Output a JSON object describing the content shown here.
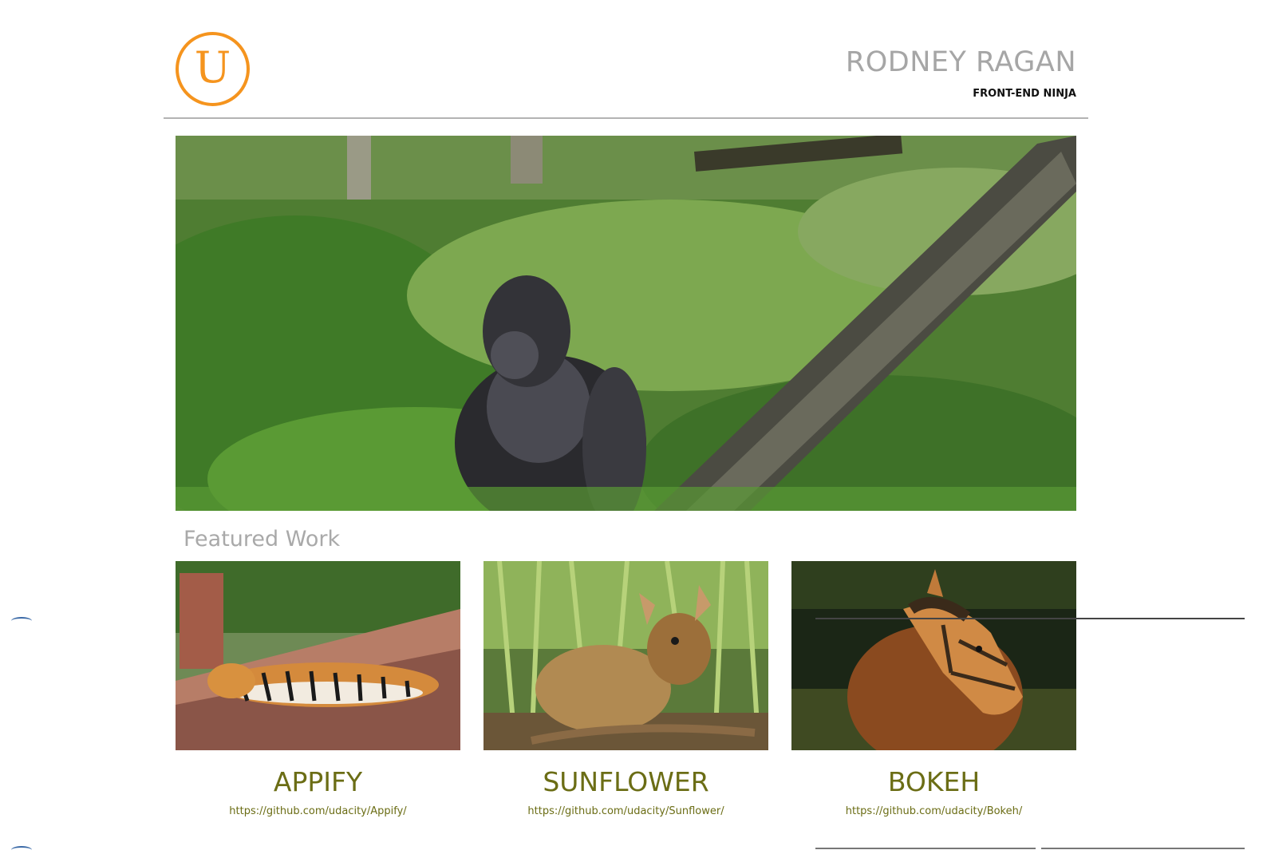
{
  "header": {
    "logo_letter": "U",
    "name": "RODNEY RAGAN",
    "tagline": "FRONT-END NINJA"
  },
  "hero": {
    "alt": "gorilla in jungle"
  },
  "featured": {
    "heading": "Featured Work",
    "items": [
      {
        "title": "APPIFY",
        "link": "https://github.com/udacity/Appify/",
        "image": "tiger"
      },
      {
        "title": "SUNFLOWER",
        "link": "https://github.com/udacity/Sunflower/",
        "image": "deer"
      },
      {
        "title": "BOKEH",
        "link": "https://github.com/udacity/Bokeh/",
        "image": "horse"
      }
    ]
  },
  "colors": {
    "accent": "#f5941e",
    "title_olive": "#6b6d15",
    "name_gray": "#a6a6a6"
  }
}
